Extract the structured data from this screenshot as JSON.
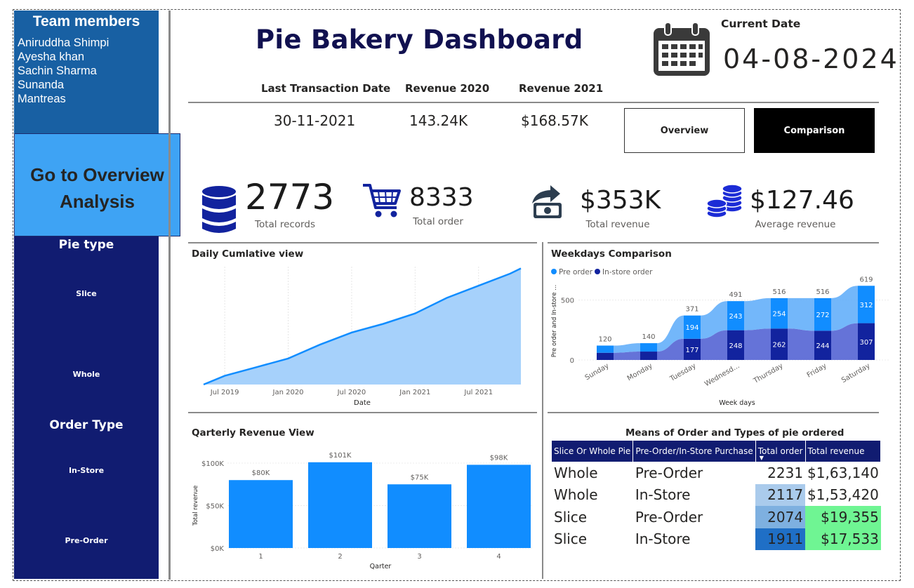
{
  "sidebar": {
    "team_title": "Team members",
    "members": [
      "Aniruddha Shimpi",
      "Ayesha khan",
      "Sachin Sharma",
      "Sunanda",
      "Mantreas"
    ],
    "go_button_line1": "Go to Overview",
    "go_button_line2": "Analysis",
    "pie_type_title": "Pie type",
    "pie_type_options": [
      "Slice",
      "Whole"
    ],
    "order_type_title": "Order Type",
    "order_type_options": [
      "In-Store",
      "Pre-Order"
    ]
  },
  "header": {
    "title": "Pie Bakery Dashboard",
    "last_txn_label": "Last Transaction Date",
    "last_txn_value": "30-11-2021",
    "rev2020_label": "Revenue 2020",
    "rev2020_value": "143.24K",
    "rev2021_label": "Revenue 2021",
    "rev2021_value": "$168.57K",
    "current_date_label": "Current Date",
    "current_date_value": "04-08-2024",
    "overview_btn": "Overview",
    "comparison_btn": "Comparison"
  },
  "kpis": {
    "records_value": "2773",
    "records_label": "Total records",
    "orders_value": "8333",
    "orders_label": "Total order",
    "revenue_value": "$353K",
    "revenue_label": "Total revenue",
    "avg_value": "$127.46",
    "avg_label": "Average revenue"
  },
  "icons": {
    "records": "database-icon",
    "orders": "shopping-cart-icon",
    "revenue": "money-share-icon",
    "avg": "coins-icon",
    "date": "calendar-icon"
  },
  "colors": {
    "navy": "#111c71",
    "team_blue": "#1860a3",
    "button_blue": "#3ea3f4",
    "chart_blue": "#118dff",
    "chart_dark": "#12239e",
    "area_fill": "#a6d1fb",
    "green_cell": "#6ff593"
  },
  "chart_data": [
    {
      "type": "area",
      "title": "Daily Cumlative view",
      "xlabel": "Date",
      "x_ticks": [
        "Jul 2019",
        "Jan 2020",
        "Jul 2020",
        "Jan 2021",
        "Jul 2021"
      ],
      "x": [
        "2019-05",
        "2019-07",
        "2019-10",
        "2020-01",
        "2020-04",
        "2020-07",
        "2020-10",
        "2021-01",
        "2021-04",
        "2021-07",
        "2021-10",
        "2021-11"
      ],
      "y": [
        0,
        25,
        50,
        75,
        115,
        150,
        175,
        205,
        250,
        285,
        320,
        335
      ],
      "grid": true
    },
    {
      "type": "bar",
      "title": "Weekdays Comparison",
      "xlabel": "Week days",
      "ylabel": "Pre order and In-store ...",
      "y_ticks": [
        "0",
        "500"
      ],
      "categories": [
        "Sunday",
        "Monday",
        "Tuesday",
        "Wednesd...",
        "Thursday",
        "Friday",
        "Saturday"
      ],
      "series": [
        {
          "name": "Pre order",
          "values": [
            60,
            70,
            194,
            243,
            254,
            272,
            312
          ],
          "labels": [
            "",
            "",
            "194",
            "243",
            "254",
            "272",
            "312"
          ]
        },
        {
          "name": "In-store order",
          "values": [
            60,
            70,
            177,
            248,
            262,
            244,
            307
          ],
          "labels": [
            "",
            "",
            "177",
            "248",
            "262",
            "244",
            "307"
          ]
        }
      ],
      "totals": [
        120,
        140,
        371,
        491,
        516,
        516,
        619
      ],
      "ylim": [
        0,
        650
      ],
      "legend": "top-left"
    },
    {
      "type": "bar",
      "title": "Qarterly Revenue View",
      "xlabel": "Qarter",
      "ylabel": "Total revenue",
      "categories": [
        "1",
        "2",
        "3",
        "4"
      ],
      "values": [
        80,
        101,
        75,
        98
      ],
      "data_labels": [
        "$80K",
        "$101K",
        "$75K",
        "$98K"
      ],
      "y_ticks": [
        "$0K",
        "$50K",
        "$100K"
      ],
      "ylim": [
        0,
        100
      ]
    },
    {
      "type": "table",
      "title": "Means of Order and Types of pie ordered",
      "columns": [
        "Slice Or Whole Pie",
        "Pre-Order/In-Store Purchase",
        "Total order",
        "Total revenue"
      ],
      "rows": [
        [
          "Whole",
          "Pre-Order",
          "2231",
          "$1,63,140"
        ],
        [
          "Whole",
          "In-Store",
          "2117",
          "$1,53,420"
        ],
        [
          "Slice",
          "Pre-Order",
          "2074",
          "$19,355"
        ],
        [
          "Slice",
          "In-Store",
          "1911",
          "$17,533"
        ]
      ],
      "order_cell_colors": [
        "#ffffff",
        "#aacbec",
        "#7eb0e0",
        "#1f6fc6"
      ],
      "revenue_cell_colors": [
        "#ffffff",
        "#ffffff",
        "#6ff593",
        "#6ff593"
      ]
    }
  ]
}
